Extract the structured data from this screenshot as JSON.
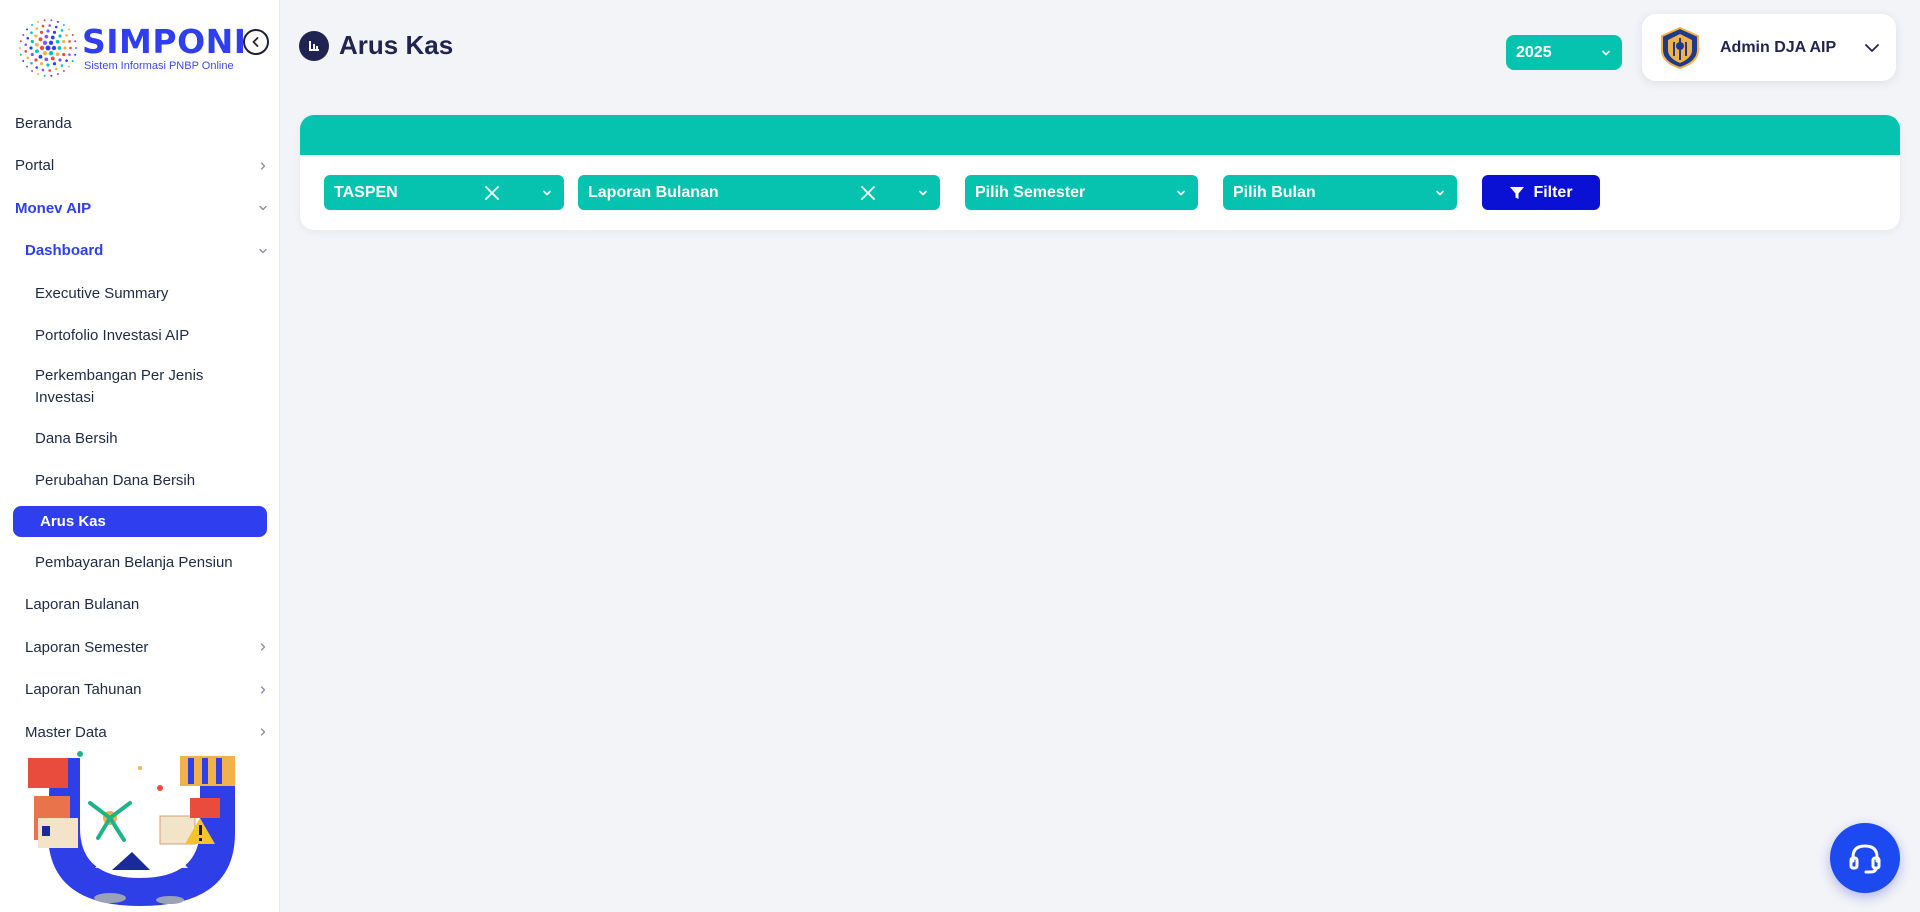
{
  "brand": {
    "title": "SIMPONI",
    "subtitle": "Sistem Informasi PNBP Online",
    "primary_color": "#2f3ff0",
    "accent_color": "#05c3ae"
  },
  "sidebar": {
    "collapse_icon": "chevron-left-circle-icon",
    "items": [
      {
        "label": "Beranda",
        "level": 0,
        "chevron": "none"
      },
      {
        "label": "Portal",
        "level": 0,
        "chevron": "right"
      },
      {
        "label": "Monev AIP",
        "level": 0,
        "chevron": "down",
        "open": true
      },
      {
        "label": "Dashboard",
        "level": 1,
        "chevron": "down",
        "open": true
      },
      {
        "label": "Executive Summary",
        "level": 2,
        "chevron": "none"
      },
      {
        "label": "Portofolio Investasi AIP",
        "level": 2,
        "chevron": "none"
      },
      {
        "label": "Perkembangan Per Jenis Investasi",
        "level": 2,
        "chevron": "none"
      },
      {
        "label": "Dana Bersih",
        "level": 2,
        "chevron": "none"
      },
      {
        "label": "Perubahan Dana Bersih",
        "level": 2,
        "chevron": "none"
      },
      {
        "label": "Arus Kas",
        "level": 2,
        "chevron": "none",
        "active": true
      },
      {
        "label": "Pembayaran Belanja Pensiun",
        "level": 2,
        "chevron": "none"
      },
      {
        "label": "Laporan Bulanan",
        "level": 1,
        "chevron": "none"
      },
      {
        "label": "Laporan Semester",
        "level": 1,
        "chevron": "right"
      },
      {
        "label": "Laporan Tahunan",
        "level": 1,
        "chevron": "right"
      },
      {
        "label": "Master Data",
        "level": 1,
        "chevron": "right"
      }
    ]
  },
  "header": {
    "title": "Arus Kas",
    "title_icon": "chart-document-icon",
    "year": "2025",
    "user_name": "Admin DJA AIP",
    "user_icon": "kemenkeu-emblem-icon"
  },
  "filters": {
    "entity": "TASPEN",
    "report_type": "Laporan Bulanan",
    "semester_placeholder": "Pilih Semester",
    "month_placeholder": "Pilih Bulan",
    "filter_label": "Filter"
  },
  "help": {
    "icon": "headset-icon"
  }
}
